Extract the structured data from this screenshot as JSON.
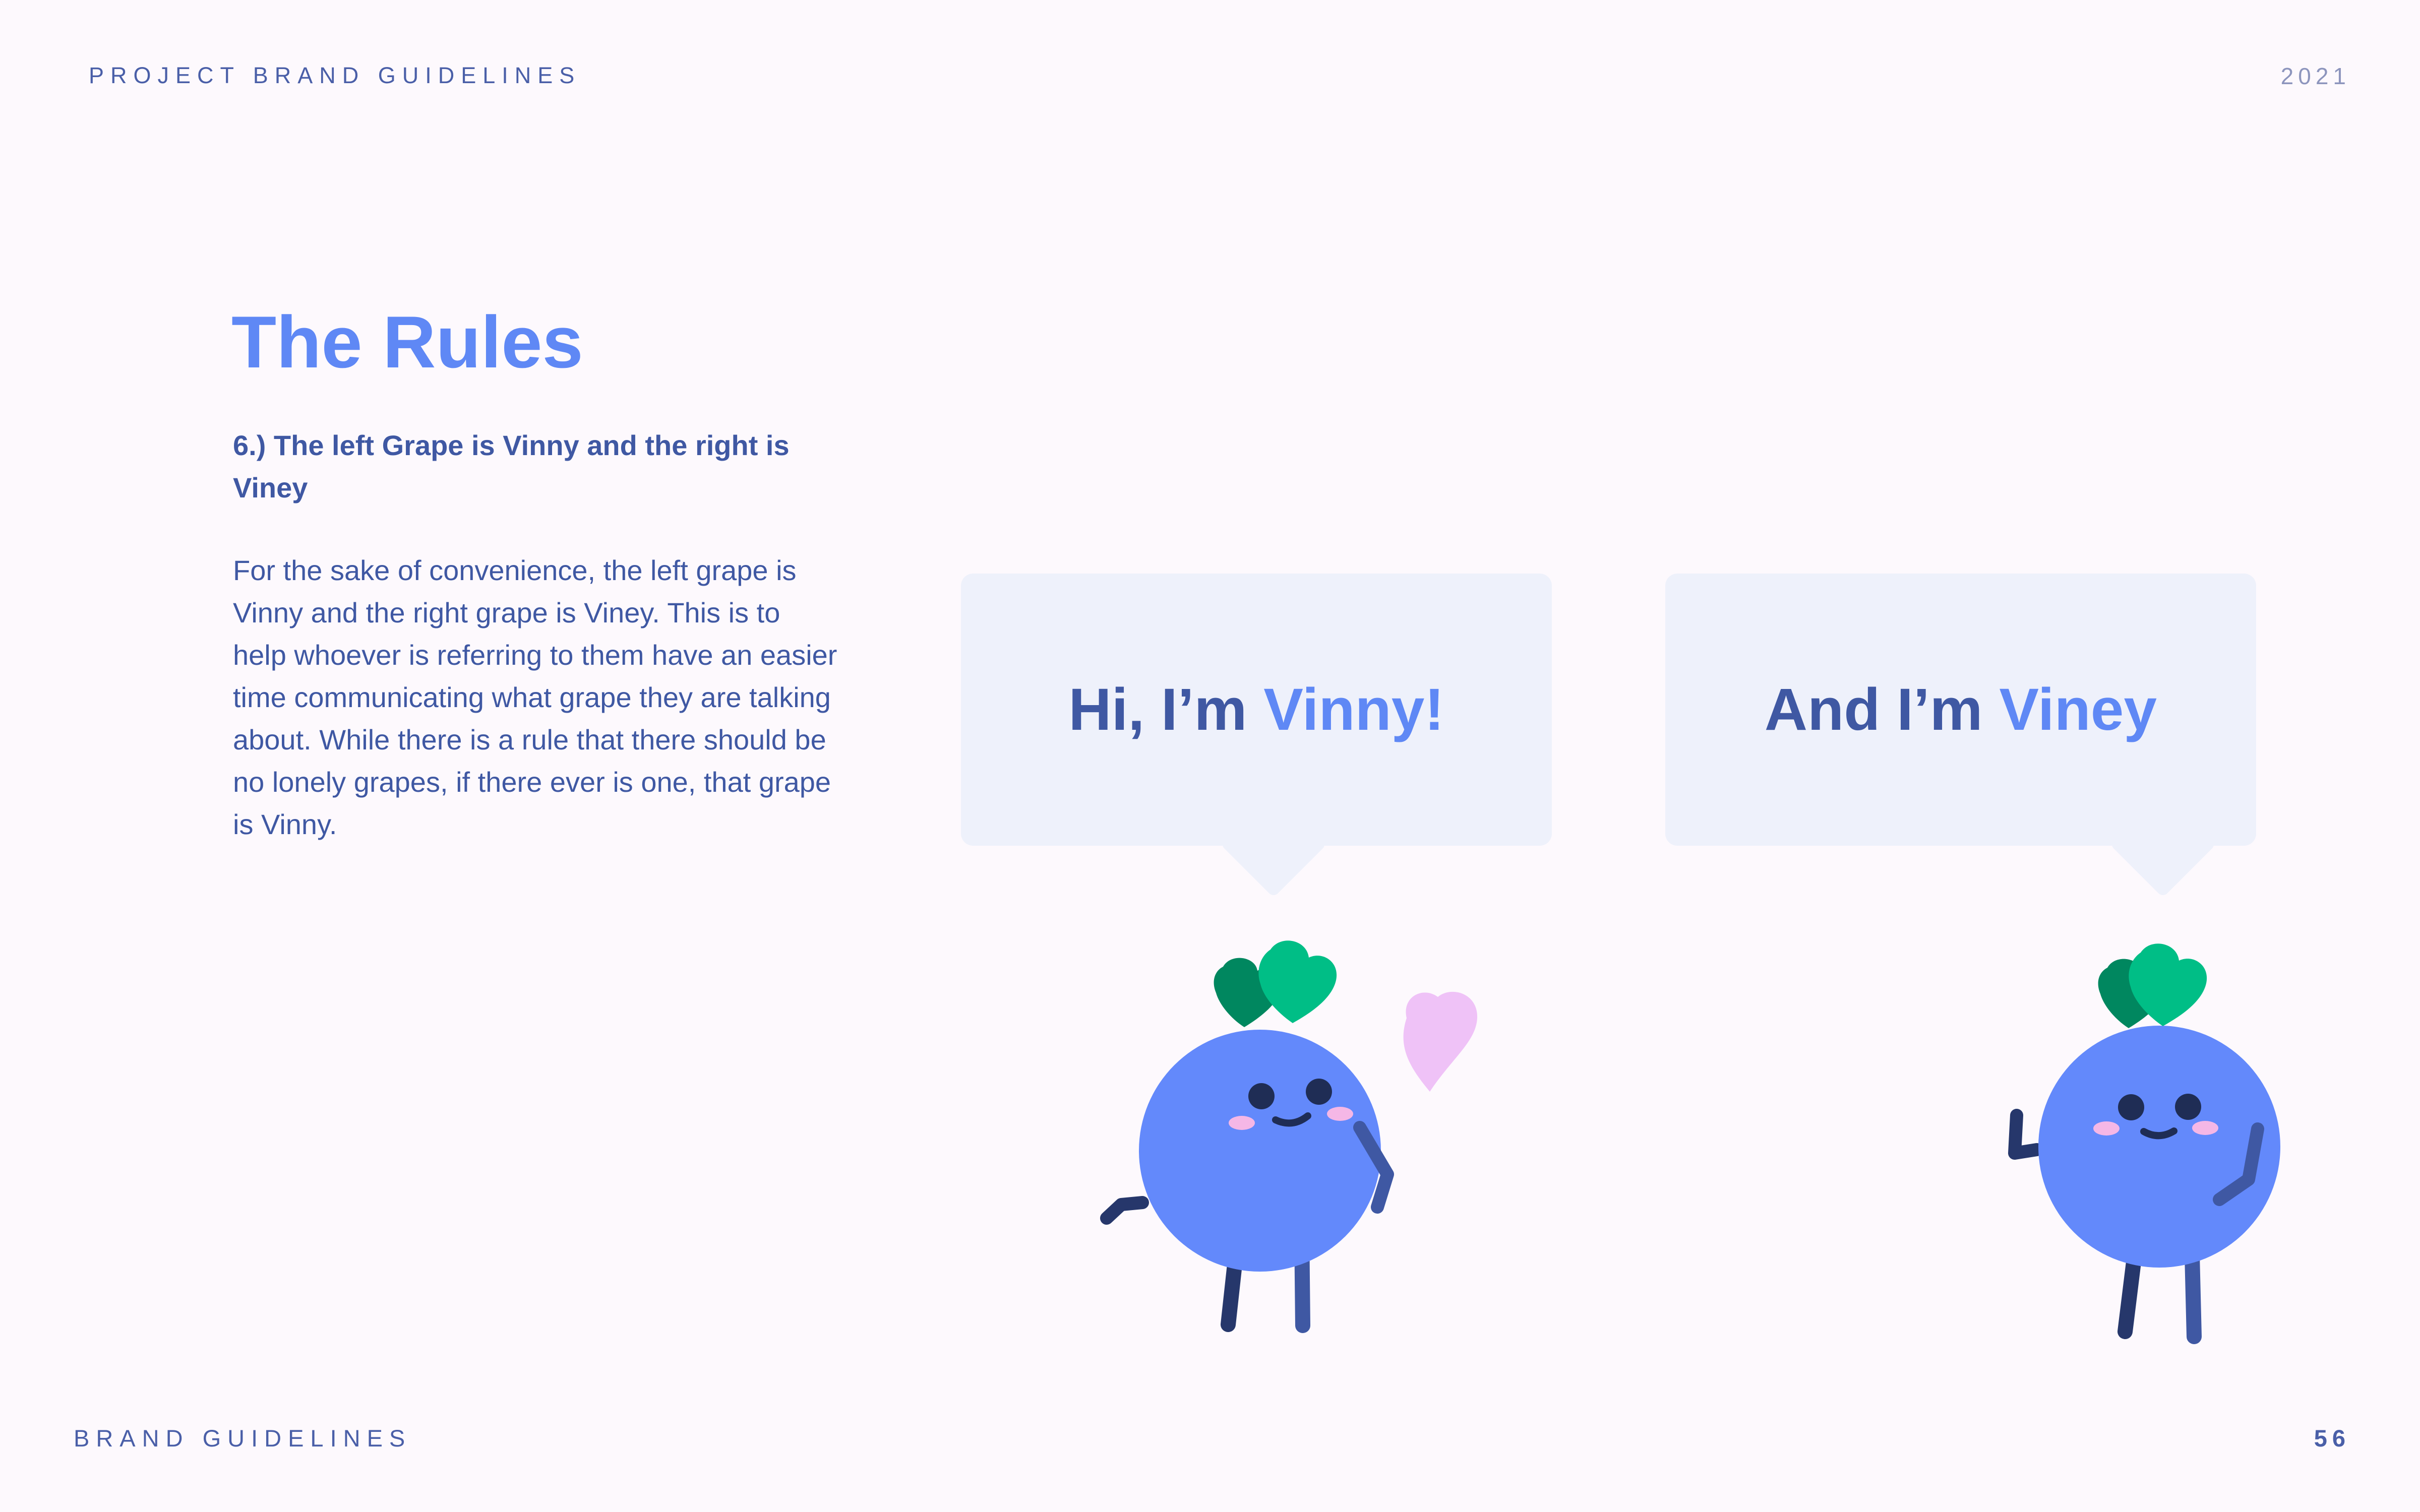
{
  "header": {
    "left": "PROJECT BRAND GUIDELINES",
    "right": "2021"
  },
  "main": {
    "title": "The Rules",
    "rule_heading": "6.) The left Grape is Vinny and the right is Viney",
    "body": "For the sake of convenience, the left grape is Vinny and the right grape is Viney. This is to help whoever is referring to them have an easier time communicating what grape they are talking about. While there is a rule that there should be no lonely grapes, if there ever is one, that grape is Vinny."
  },
  "bubbles": [
    {
      "prefix": "Hi, I’m ",
      "name": "Vinny!"
    },
    {
      "prefix": "And I’m ",
      "name": "Viney"
    }
  ],
  "footer": {
    "left": "BRAND GUIDELINES",
    "right": "56"
  },
  "colors": {
    "background": "#fdf9fd",
    "primary_blue": "#5f88f5",
    "dark_blue": "#3f58a3",
    "grape": "#6389fb",
    "leaf": "#00be86",
    "leaf_dark": "#00875f",
    "heart": "#efc2f7",
    "bubble": "#eef1fb"
  },
  "icons": [
    "grape-character-vinny",
    "grape-character-viney",
    "heart-icon",
    "leaf-icon"
  ]
}
